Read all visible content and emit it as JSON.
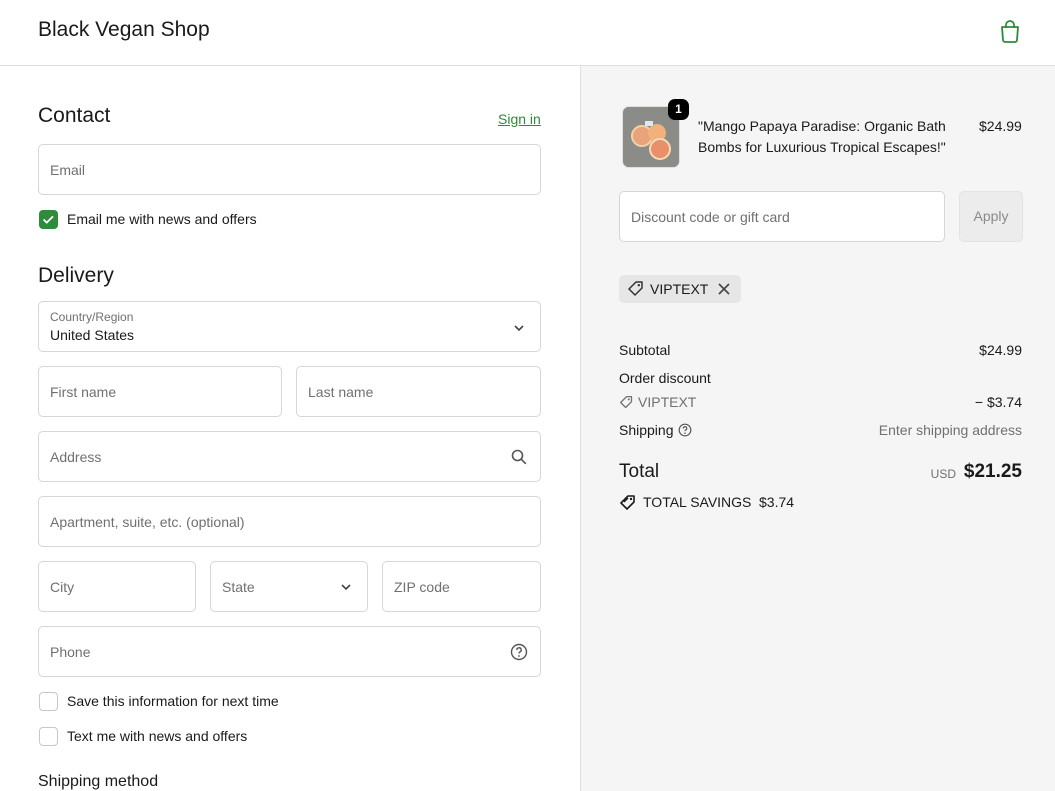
{
  "header": {
    "shop_name": "Black Vegan Shop"
  },
  "contact": {
    "title": "Contact",
    "sign_in": "Sign in",
    "email_placeholder": "Email",
    "news_label": "Email me with news and offers",
    "news_checked": true
  },
  "delivery": {
    "title": "Delivery",
    "country_label": "Country/Region",
    "country_value": "United States",
    "first_name": "First name",
    "last_name": "Last name",
    "address": "Address",
    "apartment": "Apartment, suite, etc. (optional)",
    "city": "City",
    "state": "State",
    "zip": "ZIP code",
    "phone": "Phone",
    "save_info": "Save this information for next time",
    "text_me": "Text me with news and offers"
  },
  "shipping_method": {
    "title": "Shipping method"
  },
  "summary": {
    "item": {
      "quantity": "1",
      "title": "\"Mango Papaya Paradise: Organic Bath Bombs for Luxurious Tropical Escapes!\"",
      "price": "$24.99"
    },
    "discount_placeholder": "Discount code or gift card",
    "apply_label": "Apply",
    "applied_code": "VIPTEXT",
    "subtotal_label": "Subtotal",
    "subtotal_value": "$24.99",
    "order_discount_label": "Order discount",
    "discount_code": "VIPTEXT",
    "discount_value": "− $3.74",
    "shipping_label": "Shipping",
    "shipping_value": "Enter shipping address",
    "total_label": "Total",
    "currency": "USD",
    "total_value": "$21.25",
    "savings_label": "TOTAL SAVINGS",
    "savings_value": "$3.74"
  },
  "colors": {
    "accent": "#2e8b3a",
    "panel_bg": "#f5f5f5"
  }
}
